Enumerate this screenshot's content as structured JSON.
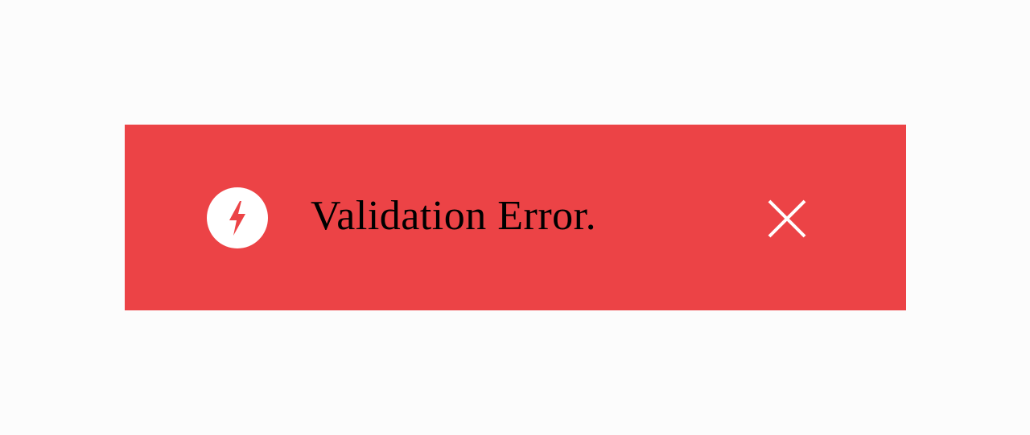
{
  "toast": {
    "message": "Validation Error.",
    "icon": "lightning-bolt-icon",
    "close_icon": "close-icon",
    "background": "#ec4346"
  }
}
